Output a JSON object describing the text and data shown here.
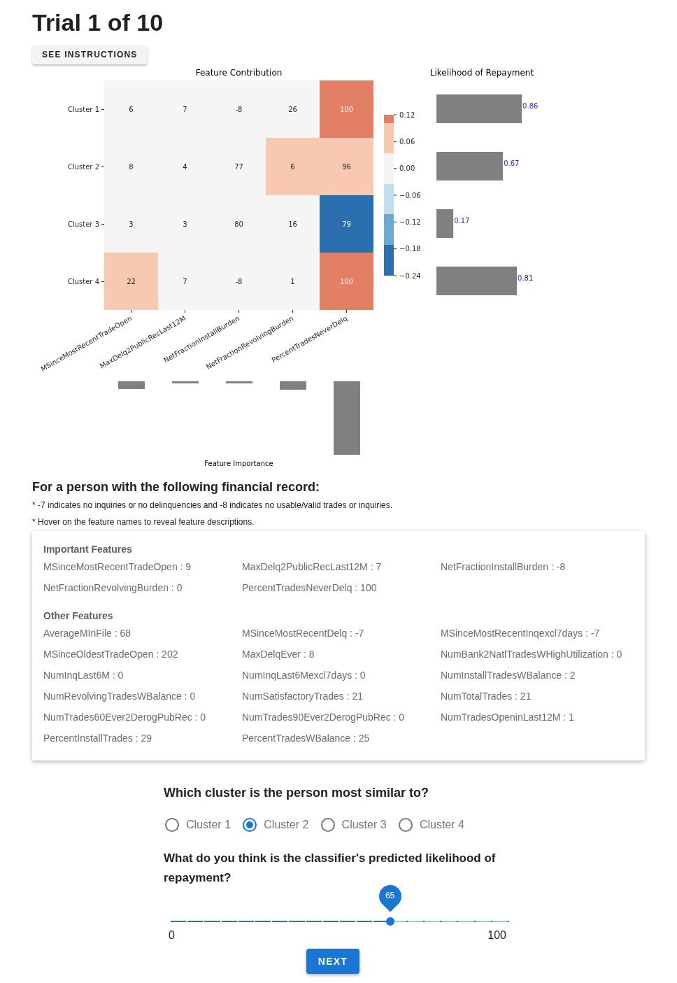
{
  "trial": {
    "title": "Trial 1 of 10",
    "instructions_button": "SEE INSTRUCTIONS"
  },
  "feature_contribution": {
    "title": "Feature Contribution",
    "rows": [
      {
        "label": "Cluster 1",
        "cells": [
          {
            "text": "6",
            "color": "#f5f5f5"
          },
          {
            "text": "7",
            "color": "#f5f5f5"
          },
          {
            "text": "-8",
            "color": "#f5f5f5"
          },
          {
            "text": "26",
            "color": "#f5f5f5"
          },
          {
            "text": "100",
            "color": "#e27f65"
          }
        ]
      },
      {
        "label": "Cluster 2",
        "cells": [
          {
            "text": "8",
            "color": "#f5f5f5"
          },
          {
            "text": "4",
            "color": "#f5f5f5"
          },
          {
            "text": "77",
            "color": "#f5f5f5"
          },
          {
            "text": "6",
            "color": "#f8c9b0"
          },
          {
            "text": "96",
            "color": "#f8c9b0"
          }
        ]
      },
      {
        "label": "Cluster 3",
        "cells": [
          {
            "text": "3",
            "color": "#f5f5f5"
          },
          {
            "text": "3",
            "color": "#f5f5f5"
          },
          {
            "text": "80",
            "color": "#f5f5f5"
          },
          {
            "text": "16",
            "color": "#f5f5f5"
          },
          {
            "text": "79",
            "color": "#2b6faf"
          }
        ]
      },
      {
        "label": "Cluster 4",
        "cells": [
          {
            "text": "22",
            "color": "#f8c9b0"
          },
          {
            "text": "7",
            "color": "#f5f5f5"
          },
          {
            "text": "-8",
            "color": "#f5f5f5"
          },
          {
            "text": "1",
            "color": "#f5f5f5"
          },
          {
            "text": "100",
            "color": "#e27f65"
          }
        ]
      }
    ],
    "x_axis_labels": [
      "MSinceMostRecentTradeOpen",
      "MaxDelq2PublicRecLast12M",
      "NetFractionInstallBurden",
      "NetFractionRevolvingBurden",
      "PercentTradesNeverDelq"
    ],
    "colorbar": {
      "ticks": [
        "0.12",
        "0.06",
        "0.00",
        "−0.06",
        "−0.12",
        "−0.18",
        "−0.24"
      ],
      "segments": [
        {
          "color": "#e27f65"
        },
        {
          "color": "#f8c9b0"
        },
        {
          "color": "#f5f5f5"
        },
        {
          "color": "#c2ddec"
        },
        {
          "color": "#6baad2"
        },
        {
          "color": "#2b6faf"
        }
      ]
    }
  },
  "likelihood": {
    "chart_data": {
      "type": "bar",
      "title": "Likelihood of Repayment",
      "orientation": "horizontal",
      "series": [
        {
          "color": "#808080",
          "values": [
            0.86,
            0.67,
            0.17,
            0.81
          ]
        }
      ],
      "data_labels": true
    }
  },
  "feature_importance": {
    "title": "Feature Importance"
  },
  "record": {
    "heading": "For a person with the following financial record:",
    "notes": [
      "* -7 indicates no inquiries or no delinquencies and -8 indicates no usable/valid trades or inquiries.",
      "* Hover on the feature names to reveal feature descriptions."
    ],
    "sections": [
      {
        "title": "Important Features",
        "items": [
          "MSinceMostRecentTradeOpen : 9",
          "MaxDelq2PublicRecLast12M : 7",
          "NetFractionInstallBurden : -8",
          "NetFractionRevolvingBurden : 0",
          "PercentTradesNeverDelq : 100"
        ]
      },
      {
        "title": "Other Features",
        "items": [
          "AverageMInFile : 68",
          "MSinceMostRecentDelq : -7",
          "MSinceMostRecentInqexcl7days : -7",
          "MSinceOldestTradeOpen : 202",
          "MaxDelqEver : 8",
          "NumBank2NatlTradesWHighUtilization : 0",
          "NumInqLast6M : 0",
          "NumInqLast6Mexcl7days : 0",
          "NumInstallTradesWBalance : 2",
          "NumRevolvingTradesWBalance : 0",
          "NumSatisfactoryTrades : 21",
          "NumTotalTrades : 21",
          "NumTrades60Ever2DerogPubRec : 0",
          "NumTrades90Ever2DerogPubRec : 0",
          "NumTradesOpeninLast12M : 1",
          "PercentInstallTrades : 29",
          "PercentTradesWBalance : 25"
        ]
      }
    ]
  },
  "cluster_question": {
    "question": "Which cluster is the person most similar to?",
    "options": [
      {
        "label": "Cluster 1",
        "selected": false
      },
      {
        "label": "Cluster 2",
        "selected": true
      },
      {
        "label": "Cluster 3",
        "selected": false
      },
      {
        "label": "Cluster 4",
        "selected": false
      }
    ]
  },
  "likelihood_question": {
    "question": "What do you think is the classifier's predicted likelihood of repayment?",
    "slider": {
      "level": 0.65,
      "value_label": "65",
      "min_label": "0",
      "max_label": "100"
    }
  },
  "next_button": "NEXT"
}
